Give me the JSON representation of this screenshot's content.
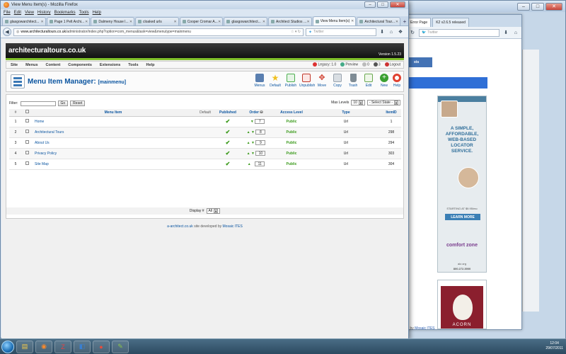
{
  "window": {
    "title": "View Menu Item(s) - Mozilla Firefox",
    "menu": [
      "File",
      "Edit",
      "View",
      "History",
      "Bookmarks",
      "Tools",
      "Help"
    ],
    "tabs": [
      {
        "label": "glasgowarchitect..."
      },
      {
        "label": "Page 1 Pelt Archi..."
      },
      {
        "label": "Dalmeny House l..."
      },
      {
        "label": "cloaked urls"
      },
      {
        "label": "Cooper Cromar A..."
      },
      {
        "label": "glasgowarchitect..."
      },
      {
        "label": "Architect Studios ..."
      },
      {
        "label": "View Menu Item(s)",
        "active": true
      },
      {
        "label": "Architectural Tour..."
      }
    ],
    "url_domain": "www.architecturaltours.co.uk",
    "url_path": "/administrator/index.php?option=com_menus&task=view&menutype=mainmenu",
    "search_placeholder": "Twitter"
  },
  "cms": {
    "site_name": "architecturaltours.co.uk",
    "version": "Version 1.5.23",
    "menu": [
      "Site",
      "Menus",
      "Content",
      "Components",
      "Extensions",
      "Tools",
      "Help"
    ],
    "status": {
      "legacy": "Legacy: 1.0",
      "preview": "Preview",
      "messages": "0",
      "users": "3",
      "logout": "Logout"
    },
    "page_title": "Menu Item Manager:",
    "page_subtitle": "[mainmenu]",
    "toolbar": [
      {
        "label": "Menus",
        "icon": "menus-icon",
        "color": "#5a7fb0"
      },
      {
        "label": "Default",
        "icon": "star-icon",
        "color": "#f0c020"
      },
      {
        "label": "Publish",
        "icon": "publish-icon",
        "color": "#4caf50"
      },
      {
        "label": "Unpublish",
        "icon": "unpublish-icon",
        "color": "#c0392b"
      },
      {
        "label": "Move",
        "icon": "move-icon",
        "color": "#d04030"
      },
      {
        "label": "Copy",
        "icon": "copy-icon",
        "color": "#9aa4ae"
      },
      {
        "label": "Trash",
        "icon": "trash-icon",
        "color": "#7f8c95"
      },
      {
        "label": "Edit",
        "icon": "edit-icon",
        "color": "#6aa84f"
      },
      {
        "label": "New",
        "icon": "new-icon",
        "color": "#3aa030"
      },
      {
        "label": "Help",
        "icon": "help-icon",
        "color": "#e04030"
      }
    ],
    "filter": {
      "label": "Filter:",
      "go": "Go",
      "reset": "Reset",
      "max_levels_label": "Max Levels",
      "max_levels_value": "10",
      "state_value": "- Select State -"
    },
    "columns": [
      "#",
      "",
      "Menu Item",
      "Default",
      "Published",
      "Order",
      "Access Level",
      "Type",
      "ItemID"
    ],
    "rows": [
      {
        "num": "1",
        "name": "Home",
        "order": "7",
        "access": "Public",
        "type": "Url",
        "id": "1"
      },
      {
        "num": "2",
        "name": "Architectural Tours",
        "order": "8",
        "access": "Public",
        "type": "Url",
        "id": "298"
      },
      {
        "num": "3",
        "name": "About Us",
        "order": "9",
        "access": "Public",
        "type": "Url",
        "id": "294"
      },
      {
        "num": "4",
        "name": "Privacy Policy",
        "order": "10",
        "access": "Public",
        "type": "Url",
        "id": "303"
      },
      {
        "num": "5",
        "name": "Site Map",
        "order": "11",
        "access": "Public",
        "type": "Url",
        "id": "304"
      }
    ],
    "display_label": "Display #",
    "display_value": "All",
    "footer_link": "a-architect.co.uk",
    "footer_text": "site developed by",
    "footer_dev": "Mosaic ITES"
  },
  "background": {
    "tab1": "Error Page",
    "tab2": "K2 v2.6.5 released",
    "search_placeholder": "Twitter",
    "ad_headline": "A SIMPLE, AFFORDABLE, WEB-BASED LOCATOR SERVICE.",
    "ad_starting": "STARTING AT $9.95/mo",
    "ad_learn": "LEARN MORE",
    "ad_brand": "comfort zone",
    "ad_url": "alz.org",
    "ad_phone": "800.272.3900",
    "ad2_text": "ACORN",
    "footnote_text": "l by",
    "footnote_link": "Mosaic ITES"
  },
  "taskbar": {
    "time": "12:04",
    "date": "29/07/2011"
  }
}
